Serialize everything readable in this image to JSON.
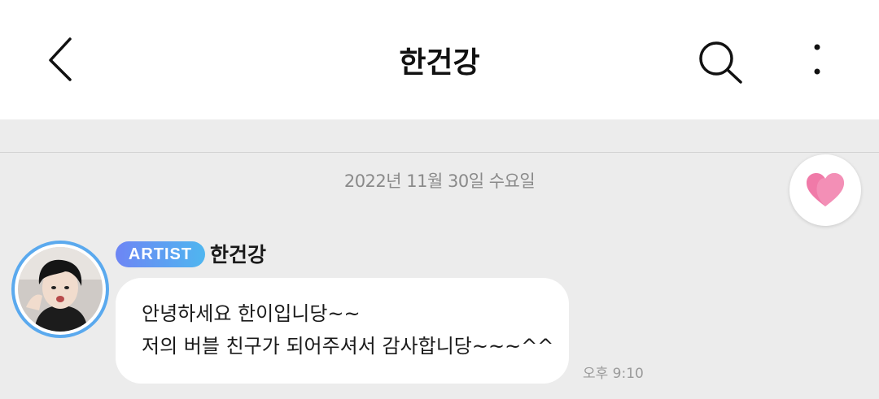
{
  "header": {
    "title": "한건강",
    "back_icon": "back-chevron-icon",
    "search_icon": "search-icon",
    "more_icon": "more-vertical-icon"
  },
  "chat": {
    "date_separator": "2022년 11월 30일 수요일",
    "heart_icon": "heart-icon",
    "heart_color": "#f07aa8",
    "message": {
      "badge": "ARTIST",
      "badge_colors": [
        "#6d85f4",
        "#4fb6f0"
      ],
      "sender": "한건강",
      "lines": [
        "안녕하세요 한이입니당~~",
        "저의 버블 친구가 되어주셔서 감사합니당~~~^^"
      ],
      "time": "오후 9:10"
    }
  }
}
